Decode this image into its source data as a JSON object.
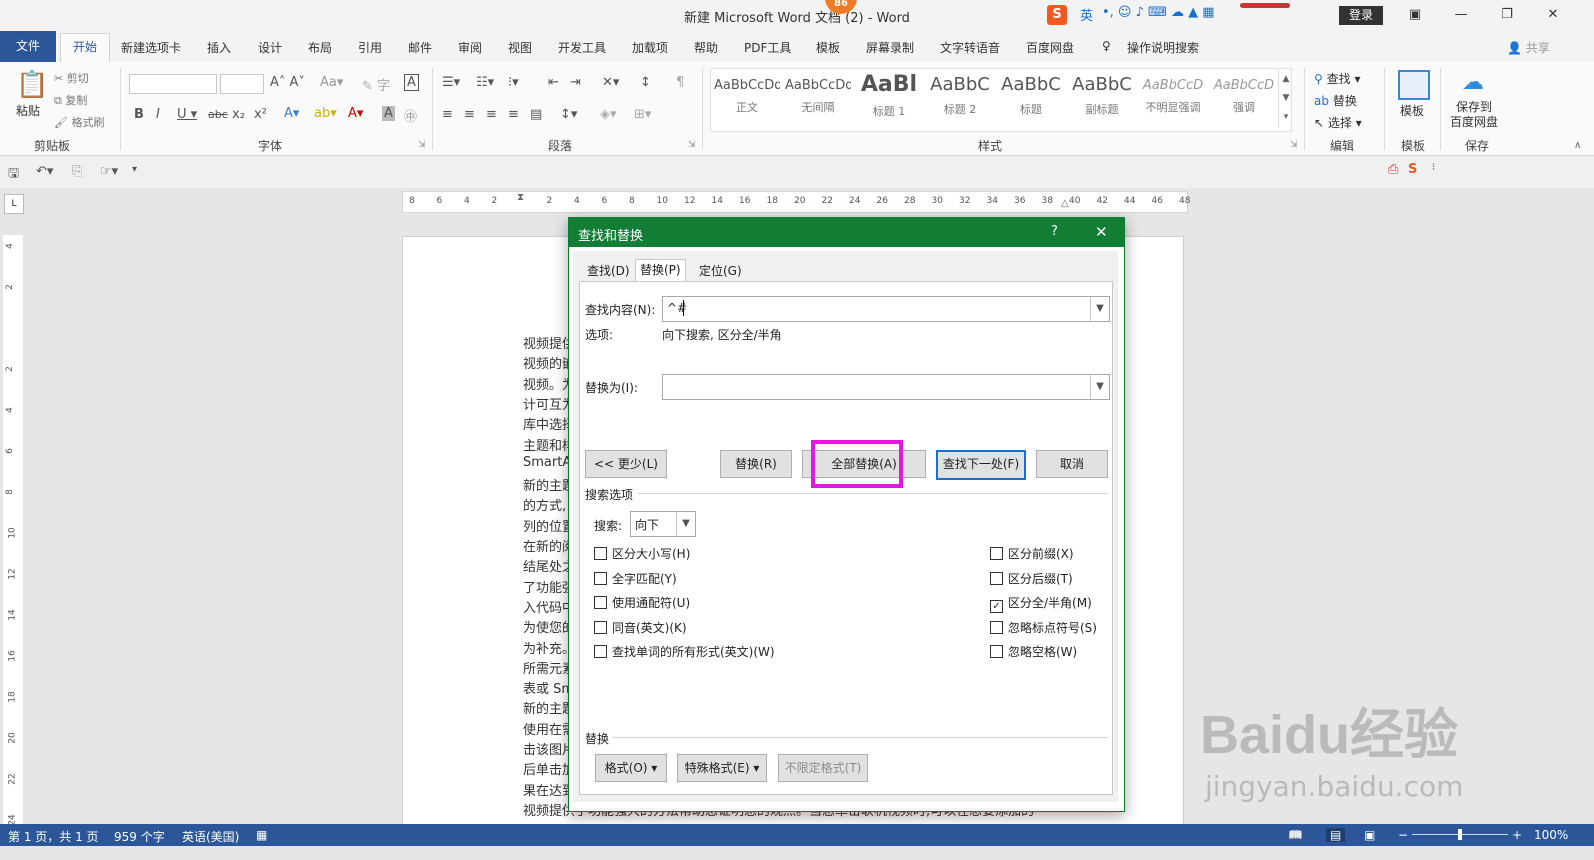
{
  "titlebar": {
    "title": "新建 Microsoft Word 文档 (2) - Word",
    "badge": "86",
    "ime_lang": "英",
    "login": "登录"
  },
  "tabs": [
    "文件",
    "开始",
    "新建选项卡",
    "插入",
    "设计",
    "布局",
    "引用",
    "邮件",
    "审阅",
    "视图",
    "开发工具",
    "加载项",
    "帮助",
    "PDF工具",
    "模板",
    "屏幕录制",
    "文字转语音",
    "百度网盘",
    "操作说明搜索"
  ],
  "share": "共享",
  "ribbon": {
    "clipboard": {
      "paste": "粘贴",
      "cut": "剪切",
      "copy": "复制",
      "painter": "格式刷",
      "label": "剪贴板"
    },
    "font": {
      "label": "字体"
    },
    "paragraph": {
      "label": "段落"
    },
    "styles": {
      "label": "样式",
      "items": [
        {
          "preview": "AaBbCcDd",
          "name": "正文"
        },
        {
          "preview": "AaBbCcDd",
          "name": "无间隔"
        },
        {
          "preview": "AaBl",
          "name": "标题 1"
        },
        {
          "preview": "AaBbC",
          "name": "标题 2"
        },
        {
          "preview": "AaBbC",
          "name": "标题"
        },
        {
          "preview": "AaBbC",
          "name": "副标题"
        },
        {
          "preview": "AaBbCcD",
          "name": "不明显强调"
        },
        {
          "preview": "AaBbCcD",
          "name": "强调"
        }
      ]
    },
    "editing": {
      "find": "查找",
      "replace": "替换",
      "select": "选择",
      "label": "编辑"
    },
    "template": {
      "name": "模板",
      "label": "模板"
    },
    "save": {
      "name": "保存到\n百度网盘",
      "label": "保存"
    }
  },
  "ruler_numbers": [
    "8",
    "6",
    "4",
    "2",
    "",
    "2",
    "4",
    "6",
    "8",
    "10",
    "12",
    "14",
    "16",
    "18",
    "20",
    "22",
    "24",
    "26",
    "28",
    "30",
    "32",
    "34",
    "36",
    "38",
    "40",
    "42",
    "44",
    "46",
    "48"
  ],
  "vruler_numbers": [
    "4",
    "2",
    "",
    "2",
    "4",
    "6",
    "8",
    "10",
    "12",
    "14",
    "16",
    "18",
    "20",
    "22",
    "24"
  ],
  "document_lines": [
    "视频提供",
    "视频的嵌",
    "视频。为",
    "计可互为",
    "库中选择",
    "主题和样",
    "SmartArt",
    "新的主题",
    "的方式,",
    "列的位置",
    "在新的阅",
    "结尾处之",
    "了功能强",
    "入代码中",
    "为使您的",
    "为补充。",
    "所需元素",
    "表或 Sm",
    "新的主题",
    "使用在需",
    "击该图片",
    "后单击加",
    "果在达到",
    "视频提供了功能强大的方法帮助您证明您的观点。当您单击联机视频时,可以在想要添加的"
  ],
  "dialog": {
    "title": "查找和替换",
    "help": "?",
    "tabs": [
      "查找(D)",
      "替换(P)",
      "定位(G)"
    ],
    "find_label": "查找内容(N):",
    "find_value": "^#",
    "options_label": "选项:",
    "options_value": "向下搜索, 区分全/半角",
    "replace_label": "替换为(I):",
    "replace_value": "",
    "buttons": {
      "less": "<< 更少(L)",
      "replace": "替换(R)",
      "replace_all": "全部替换(A)",
      "find_next": "查找下一处(F)",
      "cancel": "取消"
    },
    "search_options_label": "搜索选项",
    "search_label": "搜索:",
    "search_value": "向下",
    "left_options": [
      {
        "label": "区分大小写(H)",
        "checked": false
      },
      {
        "label": "全字匹配(Y)",
        "checked": false
      },
      {
        "label": "使用通配符(U)",
        "checked": false
      },
      {
        "label": "同音(英文)(K)",
        "checked": false
      },
      {
        "label": "查找单词的所有形式(英文)(W)",
        "checked": false
      }
    ],
    "right_options": [
      {
        "label": "区分前缀(X)",
        "checked": false
      },
      {
        "label": "区分后缀(T)",
        "checked": false
      },
      {
        "label": "区分全/半角(M)",
        "checked": true
      },
      {
        "label": "忽略标点符号(S)",
        "checked": false
      },
      {
        "label": "忽略空格(W)",
        "checked": false
      }
    ],
    "replace_section_label": "替换",
    "format_buttons": {
      "format": "格式(O) ▾",
      "special": "特殊格式(E) ▾",
      "no_format": "不限定格式(T)"
    }
  },
  "statusbar": {
    "page": "第 1 页，共 1 页",
    "words": "959 个字",
    "lang": "英语(美国)",
    "zoom": "100%"
  },
  "watermark": {
    "brand": "Baidu经验",
    "url": "jingyan.baidu.com"
  },
  "colors": {
    "word_blue": "#2b579a",
    "dialog_green": "#127d34",
    "highlight": "#e516e5"
  }
}
